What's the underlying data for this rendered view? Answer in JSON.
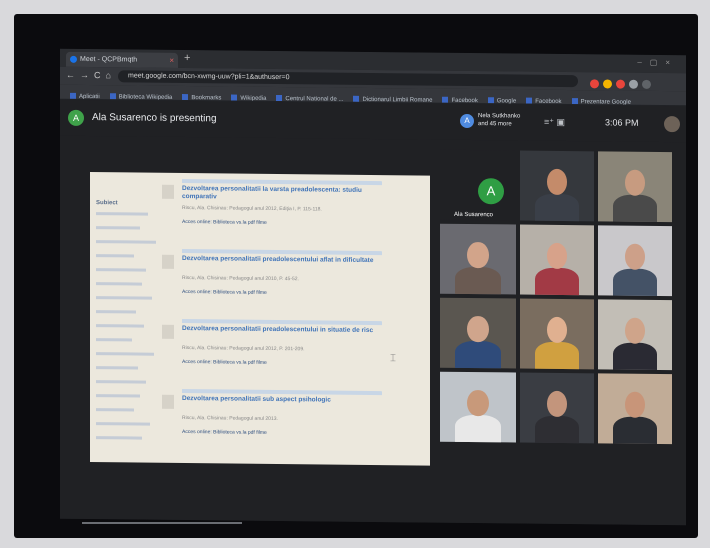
{
  "browser": {
    "tab_title": "Meet - QCPBmqth",
    "url": "meet.google.com/bcn-xwmg-uuw?pli=1&authuser=0",
    "bookmarks": [
      "Aplicatii",
      "Biblioteca Wikipedia",
      "Bookmarks",
      "Wikipedia",
      "Centrul National de ...",
      "Dictionarul Limbii Romane",
      "Facebook",
      "Google",
      "Facebook",
      "Prezentare Google"
    ],
    "extension_colors": [
      "#e8453c",
      "#f4b400",
      "#e8453c",
      "#9aa0a6",
      "#5f6368"
    ]
  },
  "meet": {
    "presenter_initial": "A",
    "presenting_text": "Ala Susarenco is presenting",
    "pinned_initial": "A",
    "pinned_text": "Nela Sutkhanko and 45 more",
    "time": "3:06 PM",
    "speaker_initial": "A",
    "speaker_name": "Ala Susarenco"
  },
  "presentation": {
    "sidebar_heading": "Subiect",
    "results": [
      {
        "title": "Dezvoltarea personalitatii la varsta preadolescenta: studiu comparativ",
        "meta": "Riscu, Ala. Chisinau: Pedagogul anul 2012, Ediţia I, P. 115-118.",
        "link": "Acces online: Biblioteca vs.la pdf filme"
      },
      {
        "title": "Dezvoltarea personalitatii preadolescentului aflat in dificultate",
        "meta": "Riscu, Ala. Chisinau: Pedagogul anul 2010, P. 45-52.",
        "link": "Acces online: Biblioteca vs.la pdf filme"
      },
      {
        "title": "Dezvoltarea personalitatii preadolescentului in situatie de risc",
        "meta": "Riscu, Ala. Chisinau: Pedagogul anul 2012, P. 201-209.",
        "link": "Acces online: Biblioteca vs.la pdf filme"
      },
      {
        "title": "Dezvoltarea personalitatii sub aspect psihologic",
        "meta": "Riscu, Ala. Chisinau: Pedagogul anul 2013.",
        "link": "Acces online: Biblioteca vs.la pdf filme"
      }
    ]
  },
  "participants": [
    {
      "bg": "#35383d",
      "face": "#c48b6a",
      "body": "#3a3f48"
    },
    {
      "bg": "#8a8578",
      "face": "#c79b80",
      "body": "#4a4a4a"
    },
    {
      "bg": "#6a6a70",
      "face": "#d2a48a",
      "body": "#6a5a52"
    },
    {
      "bg": "#b6b0a8",
      "face": "#d7a28a",
      "body": "#a23a45"
    },
    {
      "bg": "#c9c8cb",
      "face": "#cda089",
      "body": "#445266"
    },
    {
      "bg": "#5a5650",
      "face": "#d0a58c",
      "body": "#2f4b7a"
    },
    {
      "bg": "#7a6d5f",
      "face": "#e0b090",
      "body": "#d0a040"
    },
    {
      "bg": "#c2beb6",
      "face": "#cfa48a",
      "body": "#2a2a33"
    },
    {
      "bg": "#bfc4c9",
      "face": "#c8997a",
      "body": "#e8e8e8"
    },
    {
      "bg": "#3a3d43",
      "face": "#c3957c",
      "body": "#2e2e33"
    },
    {
      "bg": "#c1ac97",
      "face": "#c89579",
      "body": "#2a2d33"
    }
  ]
}
